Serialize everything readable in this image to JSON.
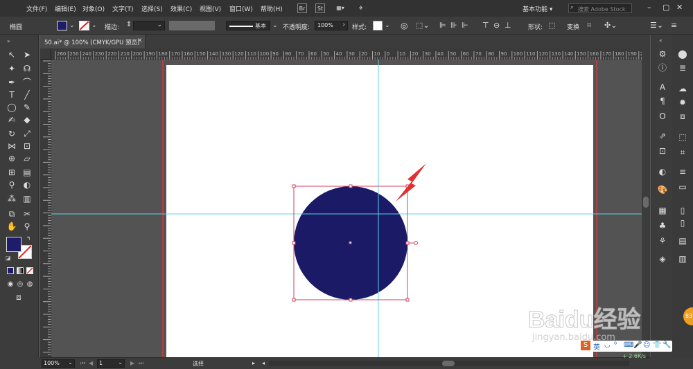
{
  "menubar": {
    "items": [
      "文件(F)",
      "编辑(E)",
      "对象(O)",
      "文字(T)",
      "选择(S)",
      "效果(C)",
      "视图(V)",
      "窗口(W)",
      "帮助(H)"
    ],
    "bridge_label": "Br",
    "stock_label": "St",
    "workspace_label": "基本功能",
    "search_placeholder": "搜索 Adobe Stock"
  },
  "controlbar": {
    "object_label": "椭圆",
    "fill_color": "#1d1d6b",
    "stroke_label": "描边:",
    "stroke_style": "基本",
    "opacity_label": "不透明度:",
    "opacity_value": "100%",
    "style_label": "样式:",
    "shape_label": "形状:",
    "transform_label": "变换"
  },
  "document": {
    "tab_title": "50.ai* @ 100% (CMYK/GPU 预览)"
  },
  "rulers": {
    "h_ticks": [
      "260",
      "250",
      "240",
      "230",
      "220",
      "210",
      "200",
      "190",
      "180",
      "170",
      "160",
      "150",
      "140",
      "130",
      "120",
      "110",
      "100",
      "90",
      "80",
      "70",
      "60",
      "50",
      "40",
      "30",
      "20",
      "10",
      "0",
      "10",
      "20",
      "30",
      "40",
      "50",
      "60",
      "70",
      "80",
      "90",
      "100",
      "110",
      "120",
      "130",
      "140",
      "150",
      "160",
      "170",
      "180",
      "190",
      "200"
    ]
  },
  "artwork": {
    "circle_fill": "#1a1a66",
    "arrow_color": "#e03030",
    "guide_color": "#5fd0e8",
    "artboard_border": "#c84040",
    "selection_color": "#d04060"
  },
  "statusbar": {
    "zoom": "100%",
    "artboard_number": "1",
    "tool_name": "选择"
  },
  "watermark": {
    "brand": "Baidu经验",
    "url": "jingyan.baidu.com",
    "net_speed": "2.6K/s",
    "badge": "83"
  }
}
